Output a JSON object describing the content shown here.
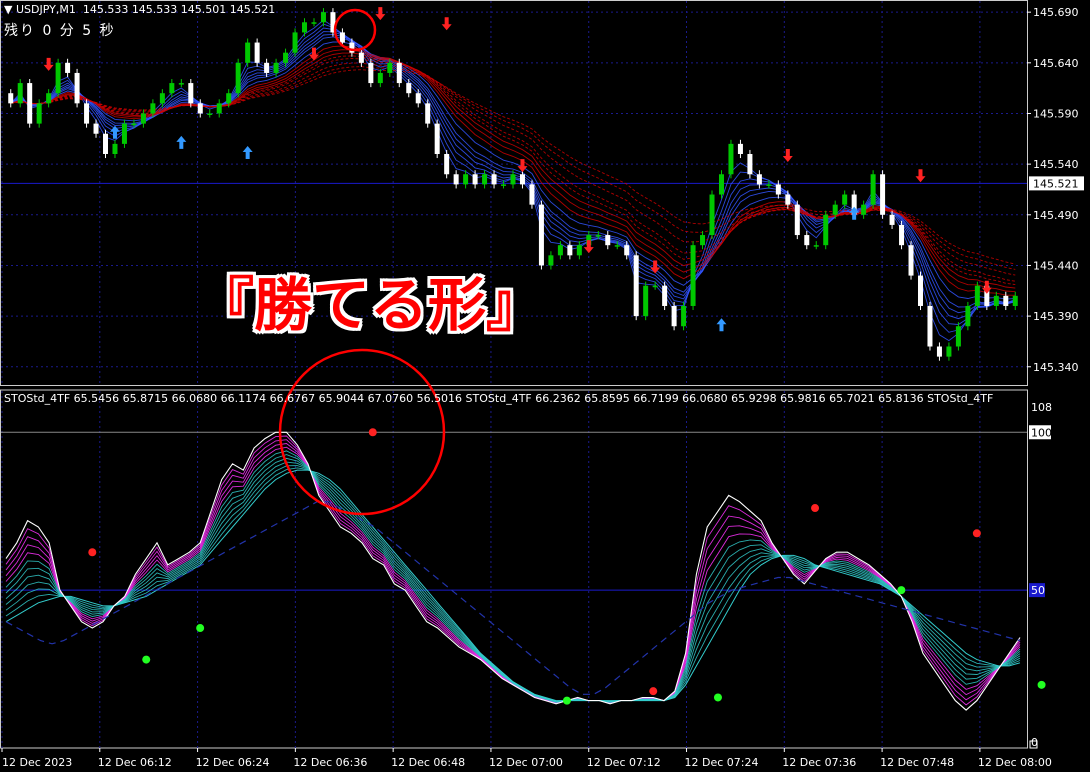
{
  "window": {
    "symbol_label": "USDJPY,M1",
    "ohlc": "145.533 145.533 145.501 145.521",
    "timer": "残り 0 分 5 秒"
  },
  "overlay_text": "『勝てる形』",
  "indicator": {
    "header": "STOStd_4TF 65.5456 65.8715 66.0680 66.1174 66.6767 65.9044 67.0760 56.5016   STOStd_4TF 66.2362 65.8595 66.7199 66.0680 65.9298 65.9816 65.7021 65.8136   STOStd_4TF"
  },
  "colors": {
    "background": "#000000",
    "grid": "#1a1a8c",
    "bull_candle": "#00c800",
    "bear_candle": "#ffffff",
    "ribbon_bear": "#cc0000",
    "ribbon_bull": "#3355ff",
    "stoch_fast": "#ffffff",
    "stoch_ribbon_a": "#ff33ff",
    "stoch_ribbon_b": "#33cccc",
    "signal_up": "#3399ff",
    "signal_down": "#ff2222",
    "highlight_circle": "#ff0000",
    "current_price_line": "#1a1acc"
  },
  "chart_data": [
    {
      "type": "candlestick",
      "symbol": "USDJPY",
      "timeframe": "M1",
      "yaxis_ticks": [
        "145.690",
        "145.640",
        "145.590",
        "145.540",
        "145.490",
        "145.440",
        "145.390",
        "145.340"
      ],
      "ylim": [
        145.322,
        145.702
      ],
      "current_price": "145.521",
      "close": [
        145.6,
        145.62,
        145.58,
        145.6,
        145.61,
        145.64,
        145.63,
        145.6,
        145.58,
        145.57,
        145.55,
        145.56,
        145.58,
        145.58,
        145.59,
        145.6,
        145.61,
        145.62,
        145.62,
        145.6,
        145.59,
        145.59,
        145.6,
        145.61,
        145.64,
        145.66,
        145.64,
        145.63,
        145.64,
        145.65,
        145.67,
        145.68,
        145.68,
        145.69,
        145.67,
        145.66,
        145.65,
        145.64,
        145.62,
        145.63,
        145.64,
        145.62,
        145.61,
        145.6,
        145.58,
        145.55,
        145.53,
        145.52,
        145.53,
        145.52,
        145.53,
        145.52,
        145.52,
        145.53,
        145.52,
        145.5,
        145.44,
        145.45,
        145.46,
        145.45,
        145.46,
        145.47,
        145.47,
        145.46,
        145.46,
        145.45,
        145.39,
        145.42,
        145.42,
        145.4,
        145.38,
        145.4,
        145.46,
        145.47,
        145.51,
        145.53,
        145.56,
        145.55,
        145.53,
        145.52,
        145.52,
        145.51,
        145.5,
        145.47,
        145.46,
        145.46,
        145.49,
        145.5,
        145.51,
        145.49,
        145.5,
        145.53,
        145.49,
        145.48,
        145.46,
        145.43,
        145.4,
        145.36,
        145.35,
        145.36,
        145.38,
        145.4,
        145.42,
        145.4,
        145.41,
        145.4,
        145.41
      ],
      "signals": [
        {
          "type": "down",
          "price": 145.64
        },
        {
          "type": "up",
          "price": 145.57
        },
        {
          "type": "up",
          "price": 145.56
        },
        {
          "type": "up",
          "price": 145.55
        },
        {
          "type": "down",
          "price": 145.65
        },
        {
          "type": "down",
          "price": 145.69
        },
        {
          "type": "down",
          "price": 145.68
        },
        {
          "type": "down",
          "price": 145.54
        },
        {
          "type": "down",
          "price": 145.46
        },
        {
          "type": "down",
          "price": 145.44
        },
        {
          "type": "up",
          "price": 145.38
        },
        {
          "type": "down",
          "price": 145.55
        },
        {
          "type": "up",
          "price": 145.49
        },
        {
          "type": "down",
          "price": 145.53
        },
        {
          "type": "down",
          "price": 145.42
        }
      ]
    },
    {
      "type": "line",
      "name": "STOStd_4TF",
      "yaxis_ticks": [
        "108",
        "100",
        "50",
        "0"
      ],
      "ylim": [
        0,
        108
      ],
      "level_line": 50,
      "fast": [
        60,
        65,
        72,
        70,
        65,
        50,
        45,
        40,
        38,
        40,
        45,
        48,
        55,
        60,
        65,
        58,
        60,
        62,
        65,
        75,
        85,
        90,
        88,
        95,
        98,
        100,
        100,
        96,
        90,
        80,
        75,
        70,
        68,
        65,
        60,
        58,
        52,
        50,
        45,
        40,
        38,
        35,
        32,
        30,
        28,
        25,
        22,
        20,
        18,
        16,
        15,
        14,
        15,
        16,
        15,
        15,
        14,
        15,
        15,
        16,
        16,
        15,
        18,
        30,
        55,
        70,
        75,
        80,
        78,
        75,
        72,
        65,
        60,
        55,
        52,
        56,
        60,
        62,
        62,
        60,
        58,
        55,
        52,
        48,
        40,
        30,
        25,
        20,
        15,
        12,
        15,
        20,
        25,
        30,
        35
      ],
      "slow": [
        40,
        42,
        44,
        46,
        47,
        48,
        48,
        47,
        46,
        45,
        45,
        46,
        47,
        48,
        50,
        52,
        54,
        56,
        58,
        62,
        66,
        70,
        74,
        78,
        82,
        85,
        87,
        88,
        88,
        87,
        85,
        82,
        78,
        74,
        70,
        66,
        62,
        58,
        54,
        50,
        46,
        42,
        38,
        34,
        30,
        27,
        24,
        21,
        19,
        17,
        16,
        15,
        15,
        15,
        15,
        15,
        15,
        15,
        15,
        15,
        15,
        15,
        16,
        20,
        26,
        32,
        38,
        44,
        50,
        55,
        58,
        60,
        61,
        61,
        60,
        58,
        57,
        56,
        55,
        54,
        53,
        52,
        50,
        48,
        45,
        42,
        39,
        36,
        33,
        30,
        28,
        27,
        26,
        26,
        27
      ],
      "trend": [
        40,
        38,
        36,
        34,
        33,
        34,
        36,
        38,
        40,
        42,
        44,
        46,
        48,
        50,
        52,
        54,
        56,
        58,
        60,
        62,
        64,
        66,
        68,
        70,
        72,
        74,
        76,
        78,
        78,
        76,
        74,
        72,
        70,
        67,
        64,
        61,
        58,
        55,
        52,
        49,
        46,
        43,
        40,
        37,
        34,
        31,
        28,
        25,
        22,
        19,
        17,
        17,
        19,
        22,
        25,
        28,
        31,
        34,
        37,
        40,
        43,
        46,
        48,
        50,
        51,
        52,
        53,
        54,
        54,
        53,
        52,
        51,
        50,
        49,
        48,
        47,
        46,
        45,
        44,
        43,
        42,
        41,
        40,
        39,
        38,
        37,
        36,
        35,
        34
      ],
      "markers_red": [
        [
          8,
          62
        ],
        [
          34,
          100
        ],
        [
          75,
          76
        ],
        [
          90,
          68
        ],
        [
          60,
          18
        ]
      ],
      "markers_green": [
        [
          13,
          28
        ],
        [
          18,
          38
        ],
        [
          52,
          15
        ],
        [
          66,
          16
        ],
        [
          83,
          50
        ],
        [
          96,
          20
        ]
      ],
      "xaxis_ticks": [
        "12 Dec 2023",
        "12 Dec 06:12",
        "12 Dec 06:24",
        "12 Dec 06:36",
        "12 Dec 06:48",
        "12 Dec 07:00",
        "12 Dec 07:12",
        "12 Dec 07:24",
        "12 Dec 07:36",
        "12 Dec 07:48",
        "12 Dec 08:00"
      ]
    }
  ]
}
